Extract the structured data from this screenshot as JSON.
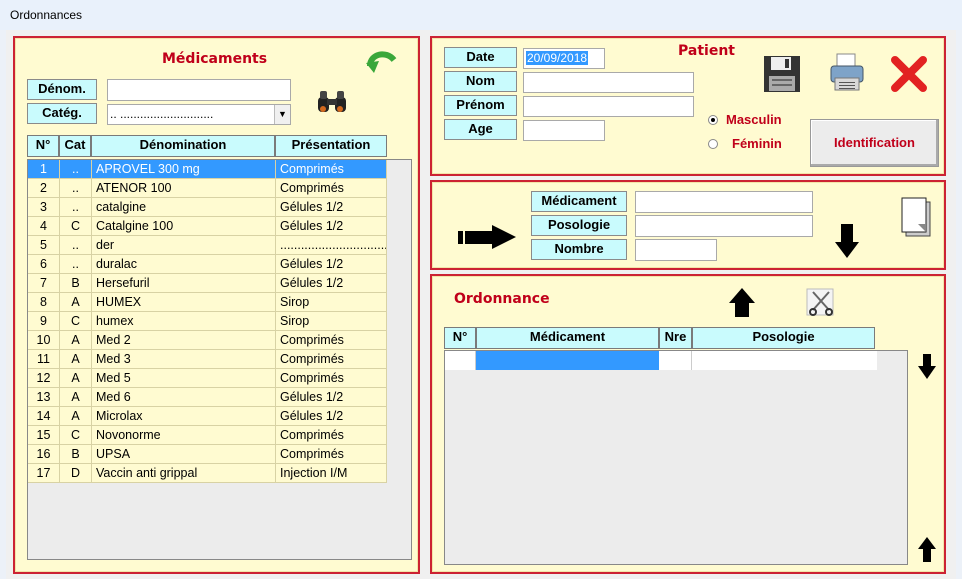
{
  "window": {
    "title": "Ordonnances"
  },
  "medicaments": {
    "title": "Médicaments",
    "denom_label": "Dénom.",
    "denom_value": "",
    "categ_label": "Catég.",
    "categ_value": "..  ............................",
    "columns": [
      "N°",
      "Cat",
      "Dénomination",
      "Présentation"
    ],
    "rows": [
      {
        "n": "1",
        "cat": "..",
        "denom": "APROVEL 300 mg",
        "pres": "Comprimés"
      },
      {
        "n": "2",
        "cat": "..",
        "denom": "ATENOR 100",
        "pres": "Comprimés"
      },
      {
        "n": "3",
        "cat": "..",
        "denom": "catalgine",
        "pres": "Gélules 1/2"
      },
      {
        "n": "4",
        "cat": "C",
        "denom": "Catalgine 100",
        "pres": "Gélules 1/2"
      },
      {
        "n": "5",
        "cat": "..",
        "denom": "der",
        "pres": "................................"
      },
      {
        "n": "6",
        "cat": "..",
        "denom": "duralac",
        "pres": "Gélules 1/2"
      },
      {
        "n": "7",
        "cat": "B",
        "denom": "Hersefuril",
        "pres": "Gélules 1/2"
      },
      {
        "n": "8",
        "cat": "A",
        "denom": "HUMEX",
        "pres": "Sirop"
      },
      {
        "n": "9",
        "cat": "C",
        "denom": "humex",
        "pres": "Sirop"
      },
      {
        "n": "10",
        "cat": "A",
        "denom": "Med 2",
        "pres": "Comprimés"
      },
      {
        "n": "11",
        "cat": "A",
        "denom": "Med 3",
        "pres": "Comprimés"
      },
      {
        "n": "12",
        "cat": "A",
        "denom": "Med 5",
        "pres": "Comprimés"
      },
      {
        "n": "13",
        "cat": "A",
        "denom": "Med 6",
        "pres": "Gélules 1/2"
      },
      {
        "n": "14",
        "cat": "A",
        "denom": "Microlax",
        "pres": "Gélules 1/2"
      },
      {
        "n": "15",
        "cat": "C",
        "denom": "Novonorme",
        "pres": "Comprimés"
      },
      {
        "n": "16",
        "cat": "B",
        "denom": "UPSA",
        "pres": "Comprimés"
      },
      {
        "n": "17",
        "cat": "D",
        "denom": "Vaccin anti grippal",
        "pres": "Injection I/M"
      }
    ]
  },
  "patient": {
    "title": "Patient",
    "date_label": "Date",
    "date_value": "20/09/2018",
    "nom_label": "Nom",
    "nom_value": "",
    "prenom_label": "Prénom",
    "prenom_value": "",
    "age_label": "Age",
    "age_value": "",
    "sex_options": [
      "Masculin",
      "Féminin"
    ],
    "sex_selected": "Masculin",
    "identification_label": "Identification"
  },
  "saisie": {
    "medicament_label": "Médicament",
    "medicament_value": "",
    "posologie_label": "Posologie",
    "posologie_value": "",
    "nombre_label": "Nombre",
    "nombre_value": ""
  },
  "ordonnance": {
    "title": "Ordonnance",
    "columns": [
      "N°",
      "Médicament",
      "Nre",
      "Posologie"
    ]
  },
  "colors": {
    "panel_border": "#cc2233",
    "panel_bg": "#fffbd1",
    "label_bg": "#c9fbfd",
    "title_red": "#c0001a",
    "selection": "#3399ff"
  },
  "icons": [
    "refresh-icon",
    "binoculars-icon",
    "save-icon",
    "printer-icon",
    "close-icon",
    "arrow-right-icon",
    "arrow-down-icon",
    "document-icon",
    "arrow-up-icon",
    "scissors-icon"
  ]
}
